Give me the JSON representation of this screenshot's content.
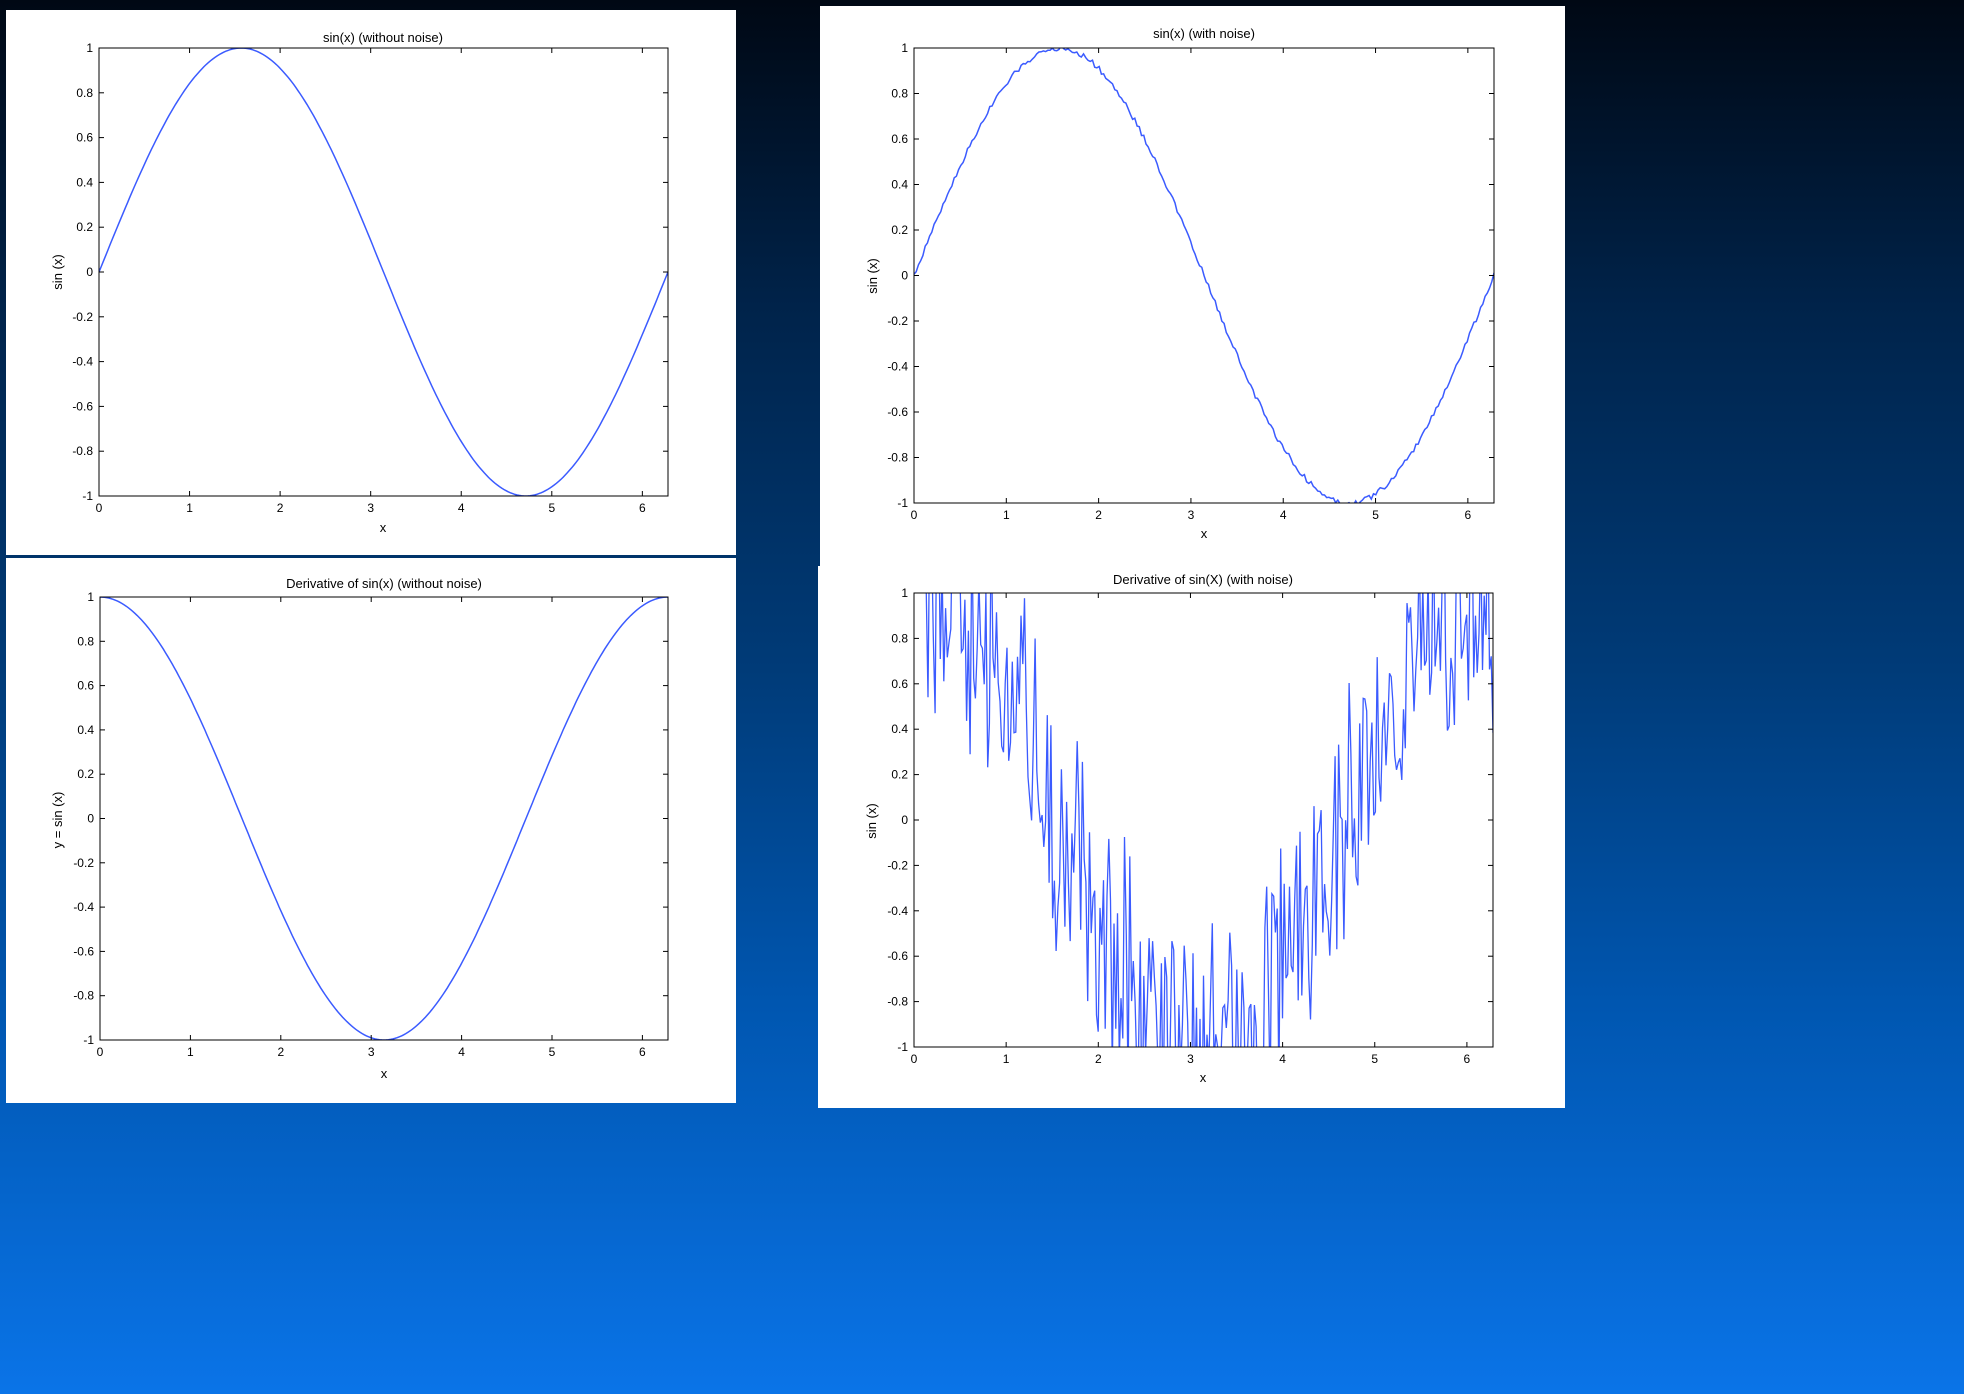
{
  "line_color": "#3b5bff",
  "background_gradient": [
    "#000814",
    "#00234a",
    "#003b78",
    "#0056b0",
    "#0a74e8"
  ],
  "chart_data": [
    {
      "type": "line",
      "title": "sin(x) (without noise)",
      "xlabel": "x",
      "ylabel": "sin (x)",
      "xlim": [
        0,
        6.2832
      ],
      "ylim": [
        -1,
        1
      ],
      "x_ticks": [
        "0",
        "1",
        "2",
        "3",
        "4",
        "5",
        "6"
      ],
      "y_ticks": [
        "1",
        "0.8",
        "0.6",
        "0.4",
        "0.2",
        "0",
        "-0.2",
        "-0.4",
        "-0.6",
        "-0.8",
        "-1"
      ],
      "series": [
        {
          "function": "sin(x)",
          "x_range": [
            0,
            6.2832
          ],
          "noise": 0
        }
      ]
    },
    {
      "type": "line",
      "title": "sin(x) (with noise)",
      "xlabel": "x",
      "ylabel": "sin (x)",
      "xlim": [
        0,
        6.2832
      ],
      "ylim": [
        -1,
        1
      ],
      "x_ticks": [
        "0",
        "1",
        "2",
        "3",
        "4",
        "5",
        "6"
      ],
      "y_ticks": [
        "1",
        "0.8",
        "0.6",
        "0.4",
        "0.2",
        "0",
        "-0.2",
        "-0.4",
        "-0.6",
        "-0.8",
        "-1"
      ],
      "series": [
        {
          "function": "sin(x)",
          "x_range": [
            0,
            6.2832
          ],
          "noise": 0.012
        }
      ]
    },
    {
      "type": "line",
      "title": "Derivative of sin(x) (without noise)",
      "xlabel": "x",
      "ylabel": "y = sin (x)",
      "xlim": [
        0,
        6.2832
      ],
      "ylim": [
        -1,
        1
      ],
      "x_ticks": [
        "0",
        "1",
        "2",
        "3",
        "4",
        "5",
        "6"
      ],
      "y_ticks": [
        "1",
        "0.8",
        "0.6",
        "0.4",
        "0.2",
        "0",
        "-0.2",
        "-0.4",
        "-0.6",
        "-0.8",
        "-1"
      ],
      "series": [
        {
          "function": "cos(x)",
          "x_range": [
            0,
            6.2832
          ],
          "noise": 0
        }
      ]
    },
    {
      "type": "line",
      "title": "Derivative of sin(X) (with noise)",
      "xlabel": "x",
      "ylabel": "sin (x)",
      "xlim": [
        0,
        6.2832
      ],
      "ylim": [
        -1,
        1
      ],
      "x_ticks": [
        "0",
        "1",
        "2",
        "3",
        "4",
        "5",
        "6"
      ],
      "y_ticks": [
        "1",
        "0.8",
        "0.6",
        "0.4",
        "0.2",
        "0",
        "-0.2",
        "-0.4",
        "-0.6",
        "-0.8",
        "-1"
      ],
      "series": [
        {
          "function": "cos(x)",
          "x_range": [
            0,
            6.2832
          ],
          "noise": 0.45
        }
      ]
    }
  ]
}
